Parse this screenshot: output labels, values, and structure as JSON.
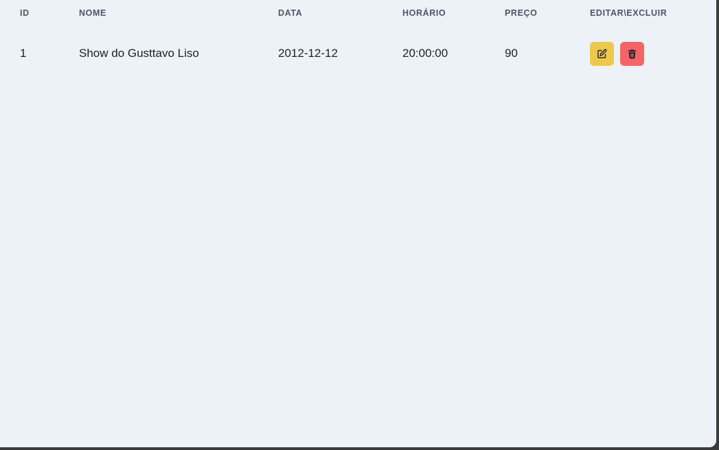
{
  "table": {
    "headers": {
      "id": "ID",
      "nome": "NOME",
      "data": "DATA",
      "horario": "HORÁRIO",
      "preco": "PREÇO",
      "acoes": "EDITAR\\EXCLUIR"
    },
    "rows": [
      {
        "id": "1",
        "nome": "Show do Gusttavo Liso",
        "data": "2012-12-12",
        "horario": "20:00:00",
        "preco": "90",
        "edit_icon": "edit-icon",
        "delete_icon": "trash-icon"
      }
    ]
  },
  "colors": {
    "background": "#edf2f7",
    "header_text": "#4a5568",
    "cell_text": "#1a202c",
    "edit_button": "#ecc94b",
    "delete_button": "#f56565"
  }
}
